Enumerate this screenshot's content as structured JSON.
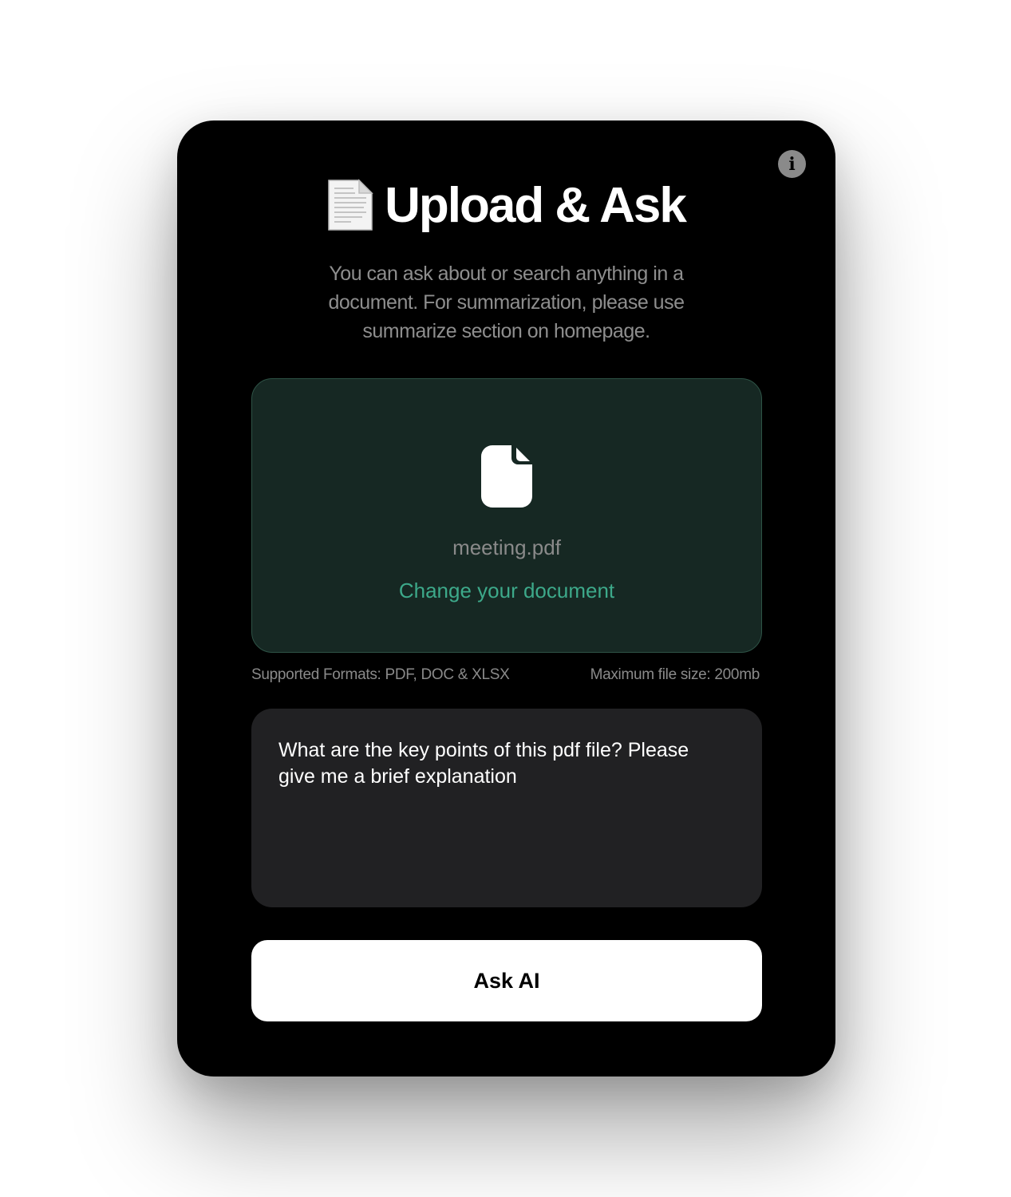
{
  "header": {
    "title": "Upload & Ask",
    "title_icon": "page-facing-up-icon",
    "subtitle": "You can ask about or search anything in a document. For summarization, please use summarize section on homepage.",
    "info_icon": "info-icon",
    "info_glyph": "i"
  },
  "upload": {
    "file_icon": "file-icon",
    "file_name": "meeting.pdf",
    "change_label": "Change your document",
    "supported_formats": "Supported Formats: PDF, DOC & XLSX",
    "max_size": "Maximum file size: 200mb"
  },
  "question": {
    "value": "What are the key points of this pdf file? Please give me a brief explanation"
  },
  "actions": {
    "ask_label": "Ask AI"
  },
  "colors": {
    "card_background": "#000000",
    "dropzone_background": "#162823",
    "dropzone_border": "#2e5346",
    "accent": "#3da98a",
    "question_background": "#212123",
    "button_background": "#ffffff",
    "muted_text": "#8e8e8e"
  }
}
